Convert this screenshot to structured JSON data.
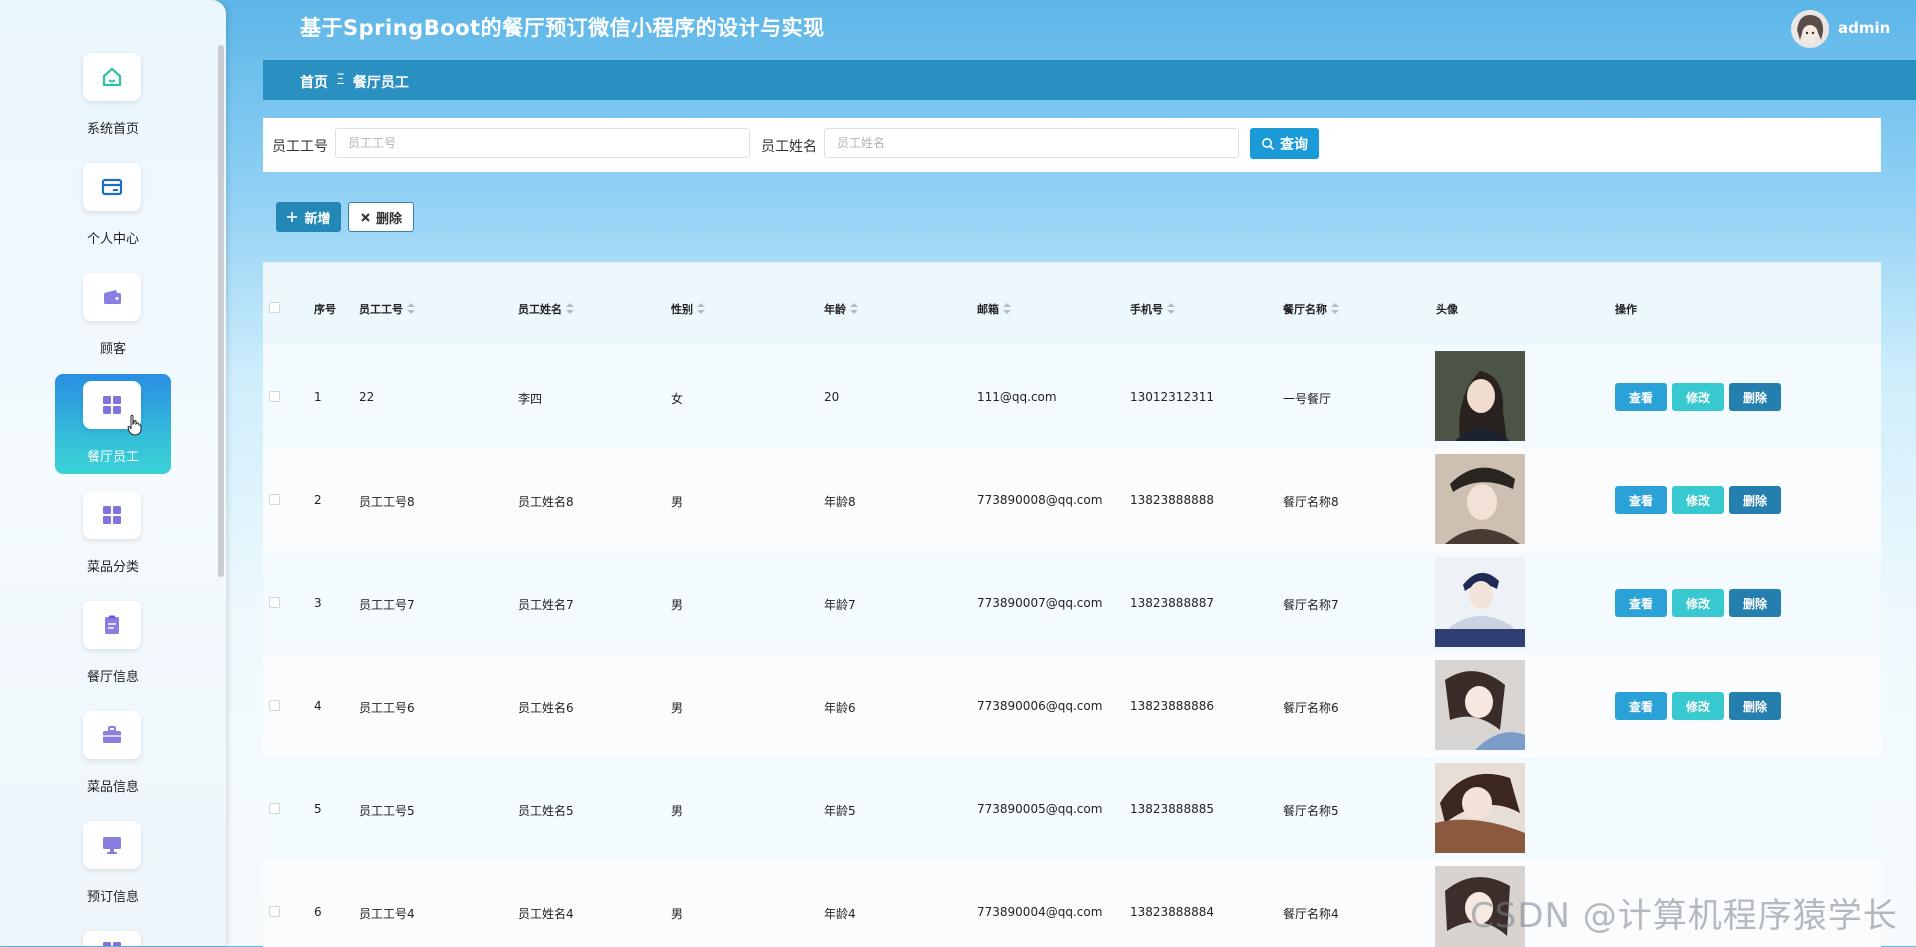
{
  "app": {
    "title": "基于SpringBoot的餐厅预订微信小程序的设计与实现"
  },
  "user": {
    "name": "admin"
  },
  "sidebar": {
    "items": [
      {
        "label": "系统首页",
        "icon": "home-icon",
        "active": false
      },
      {
        "label": "个人中心",
        "icon": "card-icon",
        "active": false
      },
      {
        "label": "顾客",
        "icon": "wallet-icon",
        "active": false
      },
      {
        "label": "餐厅员工",
        "icon": "grid-icon",
        "active": true
      },
      {
        "label": "菜品分类",
        "icon": "grid-icon",
        "active": false
      },
      {
        "label": "餐厅信息",
        "icon": "clipboard-icon",
        "active": false
      },
      {
        "label": "菜品信息",
        "icon": "briefcase-icon",
        "active": false
      },
      {
        "label": "预订信息",
        "icon": "monitor-icon",
        "active": false
      }
    ]
  },
  "breadcrumb": {
    "home": "首页",
    "separator": "Ξ",
    "current": "餐厅员工"
  },
  "search": {
    "field1_label": "员工工号",
    "field1_placeholder": "员工工号",
    "field2_label": "员工姓名",
    "field2_placeholder": "员工姓名",
    "query_label": "查询"
  },
  "actions": {
    "add_label": "新增",
    "delete_label": "删除"
  },
  "table": {
    "headers": {
      "index": "序号",
      "emp_no": "员工工号",
      "emp_name": "员工姓名",
      "gender": "性别",
      "age": "年龄",
      "email": "邮箱",
      "phone": "手机号",
      "restaurant": "餐厅名称",
      "avatar": "头像",
      "ops": "操作"
    },
    "op_labels": {
      "view": "查看",
      "edit": "修改",
      "delete": "删除"
    },
    "rows": [
      {
        "index": "1",
        "emp_no": "22",
        "emp_name": "李四",
        "gender": "女",
        "age": "20",
        "email": "111@qq.com",
        "phone": "13012312311",
        "restaurant": "一号餐厅",
        "photo_tone": "#3a3f3a",
        "has_ops": true
      },
      {
        "index": "2",
        "emp_no": "员工工号8",
        "emp_name": "员工姓名8",
        "gender": "男",
        "age": "年龄8",
        "email": "773890008@qq.com",
        "phone": "13823888888",
        "restaurant": "餐厅名称8",
        "photo_tone": "#6b5a50",
        "has_ops": true
      },
      {
        "index": "3",
        "emp_no": "员工工号7",
        "emp_name": "员工姓名7",
        "gender": "男",
        "age": "年龄7",
        "email": "773890007@qq.com",
        "phone": "13823888887",
        "restaurant": "餐厅名称7",
        "photo_tone": "#2f3f74",
        "has_ops": true
      },
      {
        "index": "4",
        "emp_no": "员工工号6",
        "emp_name": "员工姓名6",
        "gender": "男",
        "age": "年龄6",
        "email": "773890006@qq.com",
        "phone": "13823888886",
        "restaurant": "餐厅名称6",
        "photo_tone": "#a8a2a0",
        "has_ops": true
      },
      {
        "index": "5",
        "emp_no": "员工工号5",
        "emp_name": "员工姓名5",
        "gender": "男",
        "age": "年龄5",
        "email": "773890005@qq.com",
        "phone": "13823888885",
        "restaurant": "餐厅名称5",
        "photo_tone": "#8b5a3e",
        "has_ops": false
      },
      {
        "index": "6",
        "emp_no": "员工工号4",
        "emp_name": "员工姓名4",
        "gender": "男",
        "age": "年龄4",
        "email": "773890004@qq.com",
        "phone": "13823888884",
        "restaurant": "餐厅名称4",
        "photo_tone": "#9b9490",
        "has_ops": false
      }
    ]
  },
  "watermark": "CSDN @计算机程序猿学长",
  "colors": {
    "accent": "#1a9ad6",
    "breadcrumb_bg": "#2a8fc1",
    "edit": "#38c8cf",
    "delete": "#247fae"
  }
}
